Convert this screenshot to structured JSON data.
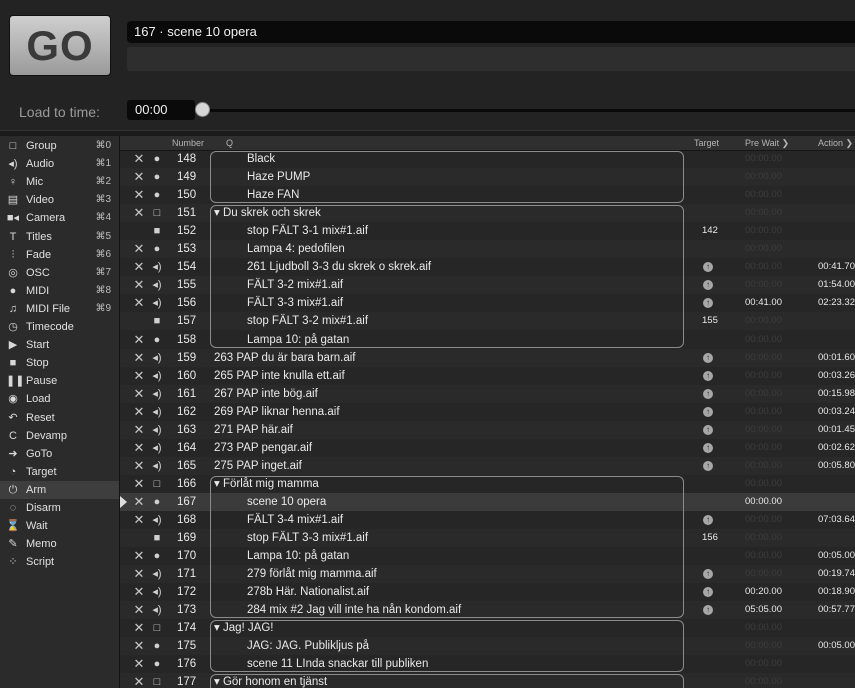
{
  "go_label": "GO",
  "standby_name": "167 · scene 10 opera",
  "load_to_time": {
    "label": "Load to time:",
    "value": "00:00"
  },
  "sidebar": [
    {
      "icon": "□",
      "icon_name": "group-icon",
      "label": "Group",
      "shortcut": "⌘0"
    },
    {
      "icon": "◂)",
      "icon_name": "audio-icon",
      "label": "Audio",
      "shortcut": "⌘1"
    },
    {
      "icon": "♀",
      "icon_name": "mic-icon",
      "label": "Mic",
      "shortcut": "⌘2"
    },
    {
      "icon": "▤",
      "icon_name": "video-icon",
      "label": "Video",
      "shortcut": "⌘3"
    },
    {
      "icon": "■◂",
      "icon_name": "camera-icon",
      "label": "Camera",
      "shortcut": "⌘4"
    },
    {
      "icon": "T",
      "icon_name": "titles-icon",
      "label": "Titles",
      "shortcut": "⌘5"
    },
    {
      "icon": "⫶",
      "icon_name": "fade-icon",
      "label": "Fade",
      "shortcut": "⌘6"
    },
    {
      "icon": "◎",
      "icon_name": "osc-icon",
      "label": "OSC",
      "shortcut": "⌘7"
    },
    {
      "icon": "●",
      "icon_name": "midi-icon",
      "label": "MIDI",
      "shortcut": "⌘8"
    },
    {
      "icon": "♫",
      "icon_name": "midi-file-icon",
      "label": "MIDI File",
      "shortcut": "⌘9"
    },
    {
      "icon": "◷",
      "icon_name": "timecode-icon",
      "label": "Timecode",
      "shortcut": ""
    },
    {
      "icon": "▶",
      "icon_name": "start-icon",
      "label": "Start",
      "shortcut": ""
    },
    {
      "icon": "■",
      "icon_name": "stop-icon",
      "label": "Stop",
      "shortcut": ""
    },
    {
      "icon": "❚❚",
      "icon_name": "pause-icon",
      "label": "Pause",
      "shortcut": ""
    },
    {
      "icon": "◉",
      "icon_name": "load-icon",
      "label": "Load",
      "shortcut": ""
    },
    {
      "icon": "↶",
      "icon_name": "reset-icon",
      "label": "Reset",
      "shortcut": ""
    },
    {
      "icon": "C",
      "icon_name": "devamp-icon",
      "label": "Devamp",
      "shortcut": ""
    },
    {
      "icon": "➜",
      "icon_name": "goto-icon",
      "label": "GoTo",
      "shortcut": ""
    },
    {
      "icon": "◔",
      "icon_name": "target-icon",
      "label": "Target",
      "shortcut": ""
    },
    {
      "icon": "⏻",
      "icon_name": "arm-icon",
      "label": "Arm",
      "shortcut": ""
    },
    {
      "icon": "◌",
      "icon_name": "disarm-icon",
      "label": "Disarm",
      "shortcut": ""
    },
    {
      "icon": "⌛",
      "icon_name": "wait-icon",
      "label": "Wait",
      "shortcut": ""
    },
    {
      "icon": "✎",
      "icon_name": "memo-icon",
      "label": "Memo",
      "shortcut": ""
    },
    {
      "icon": "⁘",
      "icon_name": "script-icon",
      "label": "Script",
      "shortcut": ""
    }
  ],
  "columns": {
    "number": "Number",
    "q": "Q",
    "target": "Target",
    "pre_wait": "Pre Wait ❯",
    "action": "Action ❯"
  },
  "cues": [
    {
      "x": "✕",
      "type": "midi",
      "number": "148",
      "name": "Black",
      "indent": true,
      "target": "",
      "pre_wait": "00:00.00",
      "action": ""
    },
    {
      "x": "✕",
      "type": "midi",
      "number": "149",
      "name": "Haze PUMP",
      "indent": true,
      "target": "",
      "pre_wait": "00:00.00",
      "action": ""
    },
    {
      "x": "✕",
      "type": "midi",
      "number": "150",
      "name": "Haze FAN",
      "indent": true,
      "target": "",
      "pre_wait": "00:00.00",
      "action": ""
    },
    {
      "x": "✕",
      "type": "group",
      "number": "151",
      "name": "▾ Du skrek och skrek",
      "indent": false,
      "target": "",
      "pre_wait": "00:00.00",
      "action": ""
    },
    {
      "x": "",
      "type": "stop",
      "number": "152",
      "name": "stop FÄLT 3-1 mix#1.aif",
      "indent": true,
      "target": "142",
      "pre_wait": "00:00.00",
      "action": ""
    },
    {
      "x": "✕",
      "type": "midi",
      "number": "153",
      "name": "Lampa 4: pedofilen",
      "indent": true,
      "target": "",
      "pre_wait": "00:00.00",
      "action": ""
    },
    {
      "x": "✕",
      "type": "audio",
      "number": "154",
      "name": "261 Ljudboll 3-3 du skrek o skrek.aif",
      "indent": true,
      "target": "circle",
      "pre_wait": "00:00.00",
      "action": "00:41.70"
    },
    {
      "x": "✕",
      "type": "audio",
      "number": "155",
      "name": "FÄLT 3-2 mix#1.aif",
      "indent": true,
      "target": "circle",
      "pre_wait": "00:00.00",
      "action": "01:54.00"
    },
    {
      "x": "✕",
      "type": "audio",
      "number": "156",
      "name": "FÄLT 3-3 mix#1.aif",
      "indent": true,
      "target": "circle",
      "pre_wait": "00:41.00",
      "action": "02:23.32"
    },
    {
      "x": "",
      "type": "stop",
      "number": "157",
      "name": "stop FÄLT 3-2 mix#1.aif",
      "indent": true,
      "target": "155",
      "pre_wait": "00:00.00",
      "action": ""
    },
    {
      "x": "✕",
      "type": "midi",
      "number": "158",
      "name": "Lampa 10: på gatan",
      "indent": true,
      "target": "",
      "pre_wait": "00:00.00",
      "action": ""
    },
    {
      "x": "✕",
      "type": "audio",
      "number": "159",
      "name": "263 PAP du är bara barn.aif",
      "indent": false,
      "target": "circle",
      "pre_wait": "00:00.00",
      "action": "00:01.60"
    },
    {
      "x": "✕",
      "type": "audio",
      "number": "160",
      "name": "265 PAP inte knulla ett.aif",
      "indent": false,
      "target": "circle",
      "pre_wait": "00:00.00",
      "action": "00:03.26"
    },
    {
      "x": "✕",
      "type": "audio",
      "number": "161",
      "name": "267 PAP inte bög.aif",
      "indent": false,
      "target": "circle",
      "pre_wait": "00:00.00",
      "action": "00:15.98"
    },
    {
      "x": "✕",
      "type": "audio",
      "number": "162",
      "name": "269 PAP liknar henna.aif",
      "indent": false,
      "target": "circle",
      "pre_wait": "00:00.00",
      "action": "00:03.24"
    },
    {
      "x": "✕",
      "type": "audio",
      "number": "163",
      "name": "271 PAP här.aif",
      "indent": false,
      "target": "circle",
      "pre_wait": "00:00.00",
      "action": "00:01.45"
    },
    {
      "x": "✕",
      "type": "audio",
      "number": "164",
      "name": "273 PAP pengar.aif",
      "indent": false,
      "target": "circle",
      "pre_wait": "00:00.00",
      "action": "00:02.62"
    },
    {
      "x": "✕",
      "type": "audio",
      "number": "165",
      "name": "275 PAP inget.aif",
      "indent": false,
      "target": "circle",
      "pre_wait": "00:00.00",
      "action": "00:05.80"
    },
    {
      "x": "✕",
      "type": "group",
      "number": "166",
      "name": "▾ Förlåt mig mamma",
      "indent": false,
      "target": "",
      "pre_wait": "00:00.00",
      "action": ""
    },
    {
      "x": "✕",
      "type": "midi",
      "number": "167",
      "name": "scene 10 opera",
      "indent": true,
      "target": "",
      "pre_wait": "00:00.00",
      "action": ""
    },
    {
      "x": "✕",
      "type": "audio",
      "number": "168",
      "name": "FÄLT 3-4 mix#1.aif",
      "indent": true,
      "target": "circle",
      "pre_wait": "00:00.00",
      "action": "07:03.64"
    },
    {
      "x": "",
      "type": "stop",
      "number": "169",
      "name": "stop FÄLT 3-3 mix#1.aif",
      "indent": true,
      "target": "156",
      "pre_wait": "00:00.00",
      "action": ""
    },
    {
      "x": "✕",
      "type": "midi",
      "number": "170",
      "name": "Lampa 10: på gatan",
      "indent": true,
      "target": "",
      "pre_wait": "00:00.00",
      "action": "00:05.00"
    },
    {
      "x": "✕",
      "type": "audio",
      "number": "171",
      "name": "279 förlåt mig mamma.aif",
      "indent": true,
      "target": "circle",
      "pre_wait": "00:00.00",
      "action": "00:19.74"
    },
    {
      "x": "✕",
      "type": "audio",
      "number": "172",
      "name": "278b Här. Nationalist.aif",
      "indent": true,
      "target": "circle",
      "pre_wait": "00:20.00",
      "action": "00:18.90"
    },
    {
      "x": "✕",
      "type": "audio",
      "number": "173",
      "name": "284 mix #2 Jag vill inte ha nån kondom.aif",
      "indent": true,
      "target": "circle",
      "pre_wait": "05:05.00",
      "action": "00:57.77"
    },
    {
      "x": "✕",
      "type": "group",
      "number": "174",
      "name": "▾ Jag! JAG!",
      "indent": false,
      "target": "",
      "pre_wait": "00:00.00",
      "action": ""
    },
    {
      "x": "✕",
      "type": "midi",
      "number": "175",
      "name": "JAG: JAG. Publikljus på",
      "indent": true,
      "target": "",
      "pre_wait": "00:00.00",
      "action": "00:05.00"
    },
    {
      "x": "✕",
      "type": "midi",
      "number": "176",
      "name": "scene 11 LInda snackar till publiken",
      "indent": true,
      "target": "",
      "pre_wait": "00:00.00",
      "action": ""
    },
    {
      "x": "✕",
      "type": "group",
      "number": "177",
      "name": "▾ Gör honom en tjänst",
      "indent": false,
      "target": "",
      "pre_wait": "00:00.00",
      "action": ""
    }
  ],
  "type_icons": {
    "midi": "●",
    "audio": "◂)",
    "group": "□",
    "stop": "■"
  },
  "colors": {
    "dim_time": "#3d3d3d",
    "bright_time": "#eaeaea",
    "playhead_row": "#3b3b3b"
  }
}
